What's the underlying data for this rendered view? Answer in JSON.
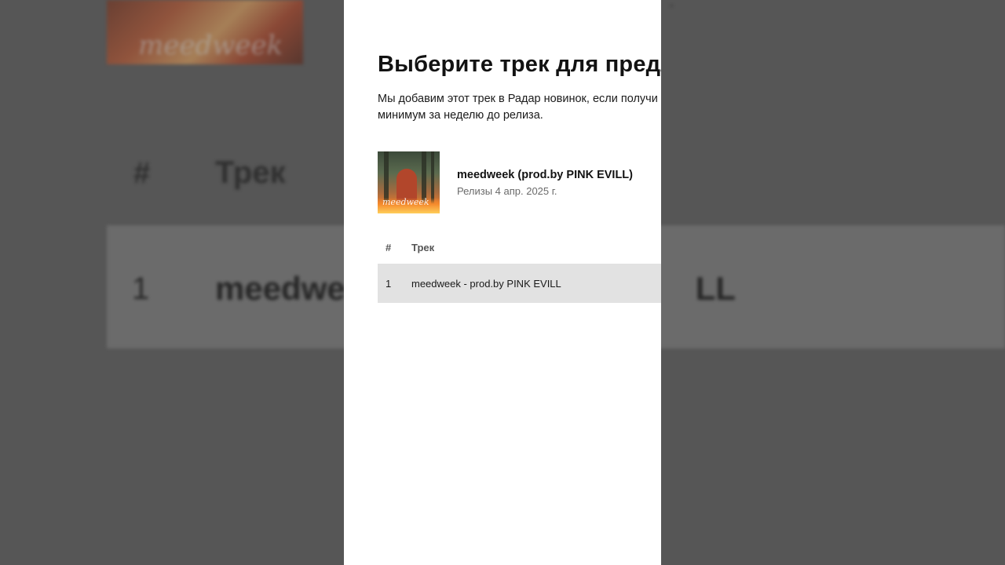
{
  "dialog": {
    "title": "Выберите трек для предл",
    "description": "Мы добавим этот трек в Радар новинок, если получ\nминимум за неделю до релиза.",
    "description_line1": "Мы добавим этот трек в Радар новинок, если получи",
    "description_line2": "минимум за неделю до релиза."
  },
  "release": {
    "name": "meedweek (prod.by PINK EVILL)",
    "date_label": "Релизы 4 апр. 2025 г.",
    "cover_text": "meedweek"
  },
  "table": {
    "header_num": "#",
    "header_track": "Трек",
    "rows": [
      {
        "num": "1",
        "title": "meedweek - prod.by PINK EVILL"
      }
    ]
  },
  "background": {
    "header_num": "#",
    "header_track": "Трек",
    "row_num": "1",
    "row_title_left": "meedwe",
    "row_title_right": "LL",
    "dot": "·"
  },
  "colors": {
    "backdrop": "#565656",
    "panel": "#ffffff",
    "selected_row": "#e2e2e2"
  }
}
